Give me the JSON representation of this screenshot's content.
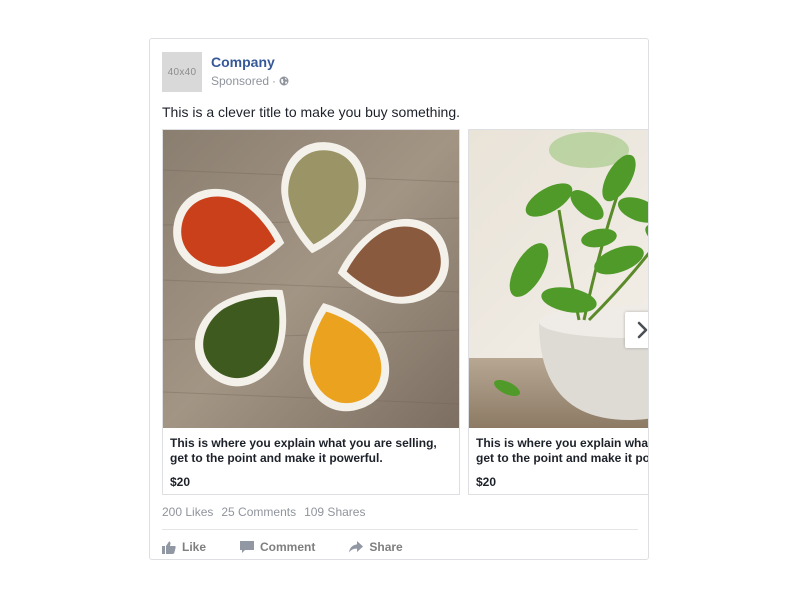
{
  "post": {
    "avatar_placeholder": "40x40",
    "company_name": "Company",
    "sponsored_label": "Sponsored",
    "separator": "·",
    "title": "This is a clever title to make you buy something.",
    "cards": [
      {
        "image": "spices-image",
        "description": "This is where you explain what you are selling, get to the point and make it powerful.",
        "price": "$20"
      },
      {
        "image": "herb-mortar-image",
        "description_line1": "This is where you explain what you are selling,",
        "description_line2": "get to the point and make it powerful.",
        "price": "$20"
      }
    ],
    "stats": {
      "likes": "200 Likes",
      "comments": "25 Comments",
      "shares": "109 Shares"
    },
    "actions": {
      "like": "Like",
      "comment": "Comment",
      "share": "Share"
    }
  },
  "colors": {
    "brand_link": "#365899",
    "muted": "#90949c",
    "border": "#dddfe2"
  },
  "icons": {
    "globe": "globe-icon",
    "next": "chevron-right-icon",
    "like": "thumbs-up-icon",
    "comment": "comment-icon",
    "share": "share-arrow-icon"
  }
}
